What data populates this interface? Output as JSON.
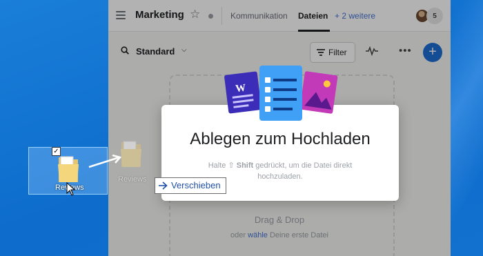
{
  "app": {
    "project_title": "Marketing",
    "tabs": [
      {
        "label": "Kommunikation"
      },
      {
        "label": "Dateien"
      },
      {
        "label": "+ 2 weitere"
      }
    ],
    "member_count": "5"
  },
  "toolbar": {
    "view_label": "Standard",
    "filter_label": "Filter"
  },
  "dropzone": {
    "title": "Drag & Drop",
    "subtitle_prefix": "oder",
    "subtitle_link": "wähle",
    "subtitle_suffix": "Deine erste Datei"
  },
  "modal": {
    "title": "Ablegen zum Hochladen",
    "body_prefix": "Halte ⇧",
    "body_key": "Shift",
    "body_suffix": "gedrückt, um die Datei direkt",
    "body_line2": "hochzuladen."
  },
  "desktop": {
    "folder_name": "Reviews",
    "ghost_folder_name": "Reviews",
    "drop_tooltip": "Verschieben"
  },
  "colors": {
    "accent": "#1f6fd6",
    "link": "#4573d2",
    "desktop": "#0d6ccc"
  },
  "icons": {
    "menu": "hamburger-icon",
    "favorite": "star-icon",
    "status": "status-dot-icon",
    "search": "search-icon",
    "filter": "filter-icon",
    "activity": "pulse-icon",
    "more": "more-dots-icon",
    "add": "plus-icon",
    "move": "arrow-right-icon"
  }
}
